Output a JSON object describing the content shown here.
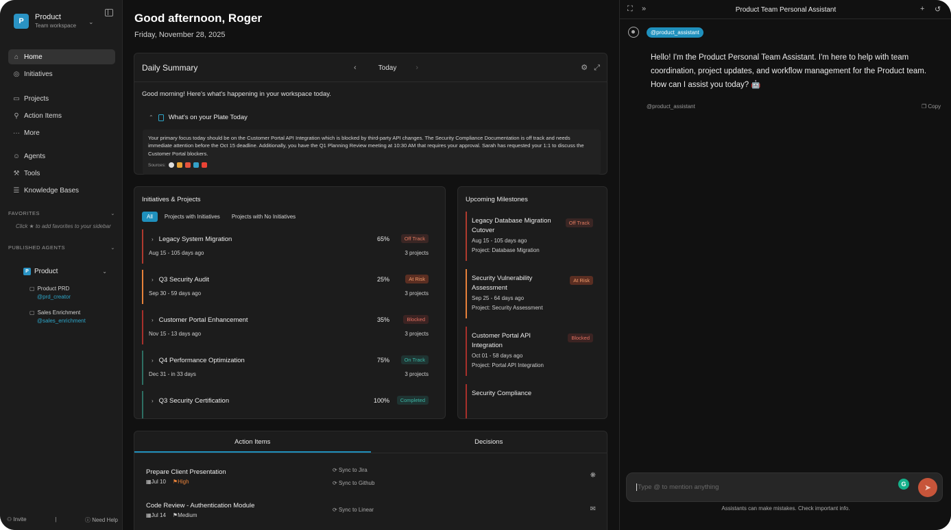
{
  "sidebar": {
    "workspace_initial": "P",
    "workspace_name": "Product",
    "workspace_sub": "Team workspace",
    "nav": [
      {
        "label": "Home",
        "icon": "home-icon"
      },
      {
        "label": "Initiatives",
        "icon": "target-icon"
      },
      {
        "label": "Projects",
        "icon": "folder-icon"
      },
      {
        "label": "Action Items",
        "icon": "action-icon"
      },
      {
        "label": "More",
        "icon": "more-icon"
      },
      {
        "label": "Agents",
        "icon": "agent-icon"
      },
      {
        "label": "Tools",
        "icon": "wrench-icon"
      },
      {
        "label": "Knowledge Bases",
        "icon": "database-icon"
      }
    ],
    "favorites_label": "FAVORITES",
    "favorites_hint": "Click ★ to add favorites to your sidebar",
    "published_label": "PUBLISHED AGENTS",
    "published_group": "Product",
    "agents": [
      {
        "name": "Product PRD",
        "handle": "@prd_creator"
      },
      {
        "name": "Sales Enrichment",
        "handle": "@sales_enrichment"
      }
    ],
    "invite": "Invite",
    "help": "Need Help"
  },
  "main": {
    "greeting": "Good afternoon, Roger",
    "date": "Friday, November 28, 2025",
    "daily_summary": {
      "title": "Daily Summary",
      "nav_label": "Today",
      "intro": "Good morning! Here's what's happening in your workspace today.",
      "plate_title": "What's on your Plate Today",
      "plate_body": "Your primary focus today should be on the Customer Portal API Integration which is blocked by third-party API changes. The Security Compliance Documentation is off track and needs immediate attention before the Oct 15 deadline. Additionally, you have the Q1 Planning Review meeting at 10:30 AM that requires your approval. Sarah has requested your 1:1 to discuss the Customer Portal blockers.",
      "sources_label": "Sources:"
    },
    "initiatives": {
      "title": "Initiatives & Projects",
      "filters": [
        "All",
        "Projects with Initiatives",
        "Projects with No Initiatives"
      ],
      "rows": [
        {
          "name": "Legacy System Migration",
          "pct": "65%",
          "status": "Off Track",
          "date": "Aug 15 - 105 days ago",
          "projects": "3 projects"
        },
        {
          "name": "Q3 Security Audit",
          "pct": "25%",
          "status": "At Risk",
          "date": "Sep 30 - 59 days ago",
          "projects": "3 projects"
        },
        {
          "name": "Customer Portal Enhancement",
          "pct": "35%",
          "status": "Blocked",
          "date": "Nov 15 - 13 days ago",
          "projects": "3 projects"
        },
        {
          "name": "Q4 Performance Optimization",
          "pct": "75%",
          "status": "On Track",
          "date": "Dec 31 - in 33 days",
          "projects": "3 projects"
        },
        {
          "name": "Q3 Security Certification",
          "pct": "100%",
          "status": "Completed",
          "date": "",
          "projects": ""
        }
      ]
    },
    "milestones": {
      "title": "Upcoming Milestones",
      "rows": [
        {
          "name": "Legacy Database Migration Cutover",
          "status": "Off Track",
          "date": "Aug 15 - 105 days ago",
          "project": "Project: Database Migration"
        },
        {
          "name": "Security Vulnerability Assessment",
          "status": "At Risk",
          "date": "Sep 25 - 64 days ago",
          "project": "Project: Security Assessment"
        },
        {
          "name": "Customer Portal API Integration",
          "status": "Blocked",
          "date": "Oct 01 - 58 days ago",
          "project": "Project: Portal API Integration"
        },
        {
          "name": "Security Compliance",
          "status": "",
          "date": "",
          "project": ""
        }
      ]
    },
    "actions": {
      "tabs": [
        "Action Items",
        "Decisions"
      ],
      "rows": [
        {
          "name": "Prepare Client Presentation",
          "date": "Jul 10",
          "priority": "High",
          "sync": [
            "Sync to Jira",
            "Sync to Github"
          ]
        },
        {
          "name": "Code Review - Authentication Module",
          "date": "Jul 14",
          "priority": "Medium",
          "sync": [
            "Sync to Linear"
          ]
        }
      ]
    }
  },
  "chat": {
    "title": "Product Team Personal Assistant",
    "mention": "@product_assistant",
    "message": "Hello! I'm the Product Personal Team Assistant. I'm here to help with team coordination, project updates, and workflow management for the Product team. How can I assist you today? 🤖",
    "from": "@product_assistant",
    "copy": "Copy",
    "placeholder": "Type @ to mention anything",
    "disclaimer": "Assistants can make mistakes. Check important info."
  },
  "colors": {
    "accent": "#1f90bd",
    "off_track": "#e07a5f",
    "at_risk": "#f09a6a",
    "on_track": "#3cb7a6"
  }
}
